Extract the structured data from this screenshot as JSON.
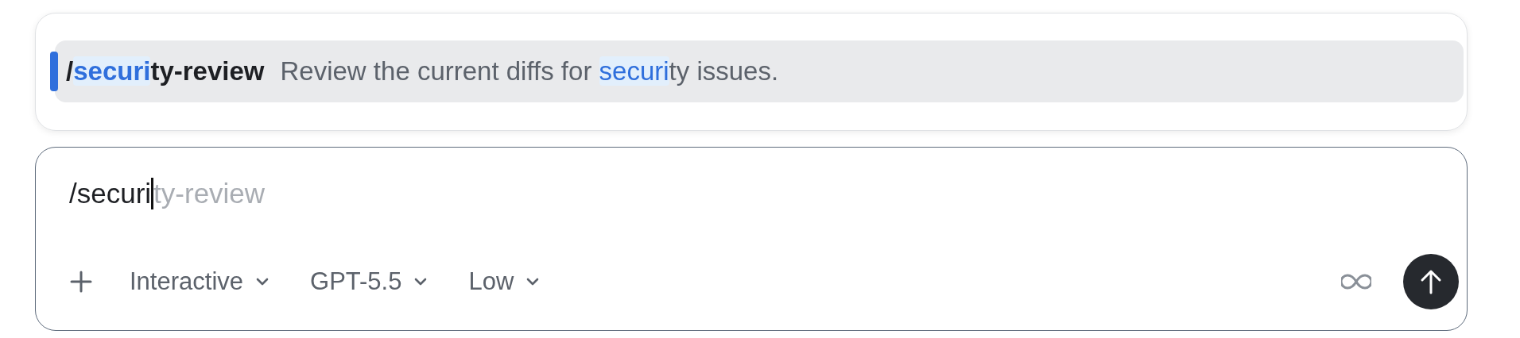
{
  "suggestions": [
    {
      "selected": true,
      "command_parts": [
        {
          "text": "/",
          "matched": false
        },
        {
          "text": "securi",
          "matched": true
        },
        {
          "text": "ty-review",
          "matched": false
        }
      ],
      "description_parts": [
        {
          "text": "Review the current diffs for ",
          "matched": false
        },
        {
          "text": "securi",
          "matched": true
        },
        {
          "text": "ty issues.",
          "matched": false
        }
      ]
    }
  ],
  "composer": {
    "value": "/securi",
    "completion": "ty-review",
    "dropdowns": [
      {
        "label": "Interactive"
      },
      {
        "label": "GPT-5.5"
      },
      {
        "label": "Low"
      }
    ]
  }
}
